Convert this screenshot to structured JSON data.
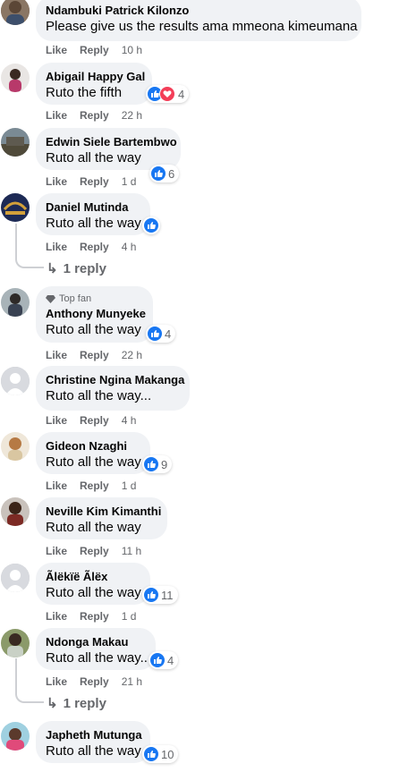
{
  "comments": [
    {
      "name": "Ndambuki Patrick Kilonzo",
      "text": "Please give us the results ama mmeona kimeumana",
      "time": "10 h",
      "reactions": null
    },
    {
      "name": "Abigail Happy Gal",
      "text": "Ruto the fifth",
      "time": "22 h",
      "reactions": "4"
    },
    {
      "name": "Edwin Siele Bartembwo",
      "text": "Ruto all the way",
      "time": "1 d",
      "reactions": "6"
    },
    {
      "name": "Daniel Mutinda",
      "text": "Ruto all the way",
      "time": "4 h",
      "reactions": ""
    },
    {
      "name": "Anthony Munyeke",
      "badge": "Top fan",
      "text": "Ruto all the way",
      "time": "22 h",
      "reactions": "4"
    },
    {
      "name": "Christine Ngina Makanga",
      "text": "Ruto all the way...",
      "time": "4 h",
      "reactions": null
    },
    {
      "name": "Gideon Nzaghi",
      "text": "Ruto all the way",
      "time": "1 d",
      "reactions": "9"
    },
    {
      "name": "Neville Kim Kimanthi",
      "text": "Ruto all the way",
      "time": "11 h",
      "reactions": null
    },
    {
      "name": "Ãlëkïë Ãlëx",
      "text": "Ruto all the way",
      "time": "1 d",
      "reactions": "11"
    },
    {
      "name": "Ndonga Makau",
      "text": "Ruto all the way..",
      "time": "21 h",
      "reactions": "4"
    },
    {
      "name": "Japheth Mutunga",
      "text": "Ruto all the way",
      "time": "",
      "reactions": "10"
    }
  ],
  "labels": {
    "like": "Like",
    "reply": "Reply"
  },
  "replies": [
    "1 reply",
    "1 reply"
  ],
  "colors": {
    "like": "#1877f2",
    "love": "#f33e58",
    "bubble": "#f0f2f5",
    "meta": "#65676b"
  }
}
